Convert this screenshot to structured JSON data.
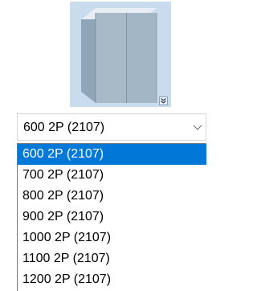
{
  "preview": {
    "image_icon": "cabinet-2-door-preview-icon",
    "expand_icon": "double-chevron-down-icon"
  },
  "combo": {
    "value": "600 2P (2107)",
    "chevron_icon": "chevron-down-icon"
  },
  "dropdown": {
    "options": [
      "600 2P (2107)",
      "700 2P (2107)",
      "800 2P (2107)",
      "900 2P (2107)",
      "1000 2P (2107)",
      "1100 2P (2107)",
      "1200 2P (2107)"
    ],
    "selected_index": 0
  },
  "colors": {
    "selection": "#0078d7",
    "preview_bg": "#c8dced"
  }
}
